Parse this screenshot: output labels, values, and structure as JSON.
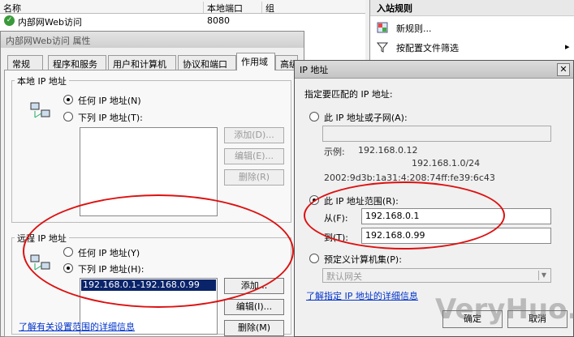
{
  "list": {
    "columns": [
      "名称",
      "本地端口",
      "组"
    ],
    "rows": [
      {
        "name": "内部网Web访问",
        "port": "8080",
        "group": ""
      }
    ]
  },
  "actions": {
    "title": "入站规则",
    "items": [
      {
        "label": "新规则...",
        "icon": "new-rule-icon"
      },
      {
        "label": "按配置文件筛选",
        "icon": "filter-icon"
      }
    ]
  },
  "props_dialog": {
    "title": "内部网Web访问 属性",
    "tabs": [
      "常规",
      "程序和服务",
      "用户和计算机",
      "协议和端口",
      "作用域",
      "高级"
    ],
    "active_tab": "作用域",
    "local": {
      "legend": "本地 IP 地址",
      "any": "任何 IP 地址(N)",
      "these": "下列 IP 地址(T):",
      "add": "添加(D)...",
      "edit": "编辑(E)...",
      "remove": "删除(R)"
    },
    "remote": {
      "legend": "远程 IP 地址",
      "any": "任何 IP 地址(Y)",
      "these": "下列 IP 地址(H):",
      "entries": [
        "192.168.0.1-192.168.0.99"
      ],
      "add": "添加...",
      "edit": "编辑(I)...",
      "remove": "删除(M)"
    },
    "link": "了解有关设置范围的详细信息"
  },
  "ip_dialog": {
    "title": "IP 地址",
    "prompt": "指定要匹配的 IP 地址:",
    "subnet_option": "此 IP 地址或子网(A):",
    "example_label": "示例:",
    "examples": [
      "192.168.0.12",
      "192.168.1.0/24",
      "2002:9d3b:1a31:4:208:74ff:fe39:6c43"
    ],
    "range_option": "此 IP 地址范围(R):",
    "from_label": "从(F):",
    "from_value": "192.168.0.1",
    "to_label": "到(T):",
    "to_value": "192.168.0.99",
    "predefined_option": "预定义计算机集(P):",
    "predefined_value": "默认网关",
    "link": "了解指定 IP 地址的详细信息",
    "ok": "确定",
    "cancel": "取消"
  },
  "watermark": "VeryHuo.com"
}
